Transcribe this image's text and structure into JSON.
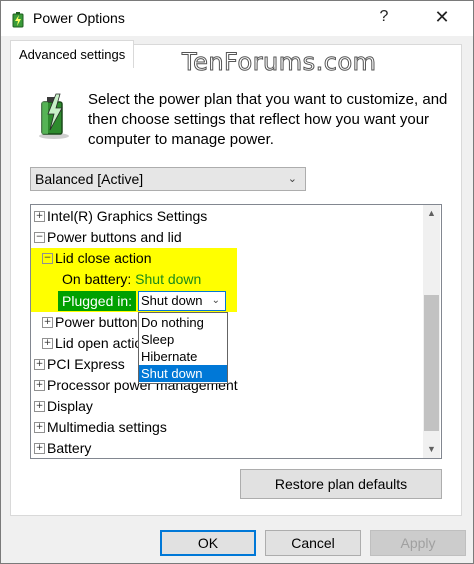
{
  "window": {
    "title": "Power Options",
    "help_icon": "?",
    "close_icon": "✕"
  },
  "tab": {
    "label": "Advanced settings"
  },
  "watermark": "TenForums.com",
  "description": "Select the power plan that you want to customize, and then choose settings that reflect how you want your computer to manage power.",
  "plan_select": {
    "value": "Balanced [Active]"
  },
  "tree": {
    "items": [
      {
        "expander": "+",
        "label": "Intel(R) Graphics Settings"
      },
      {
        "expander": "−",
        "label": "Power buttons and lid"
      },
      {
        "expander": "−",
        "label": "Lid close action"
      },
      {
        "label": "On battery:",
        "value": "Shut down"
      },
      {
        "label": "Plugged in:",
        "value": "Shut down"
      },
      {
        "expander": "+",
        "label": "Power button"
      },
      {
        "expander": "+",
        "label": "Lid open actio"
      },
      {
        "expander": "+",
        "label": "PCI Express"
      },
      {
        "expander": "+",
        "label": "Processor power management"
      },
      {
        "expander": "+",
        "label": "Display"
      },
      {
        "expander": "+",
        "label": "Multimedia settings"
      },
      {
        "expander": "+",
        "label": "Battery"
      }
    ]
  },
  "dropdown": {
    "options": [
      "Do nothing",
      "Sleep",
      "Hibernate",
      "Shut down"
    ],
    "selected": "Shut down"
  },
  "buttons": {
    "restore": "Restore plan defaults",
    "ok": "OK",
    "cancel": "Cancel",
    "apply": "Apply"
  },
  "colors": {
    "highlight_yellow": "#ffff00",
    "highlight_green": "#00a000",
    "value_green": "#1a8a1a",
    "selection_blue": "#0078d7"
  }
}
